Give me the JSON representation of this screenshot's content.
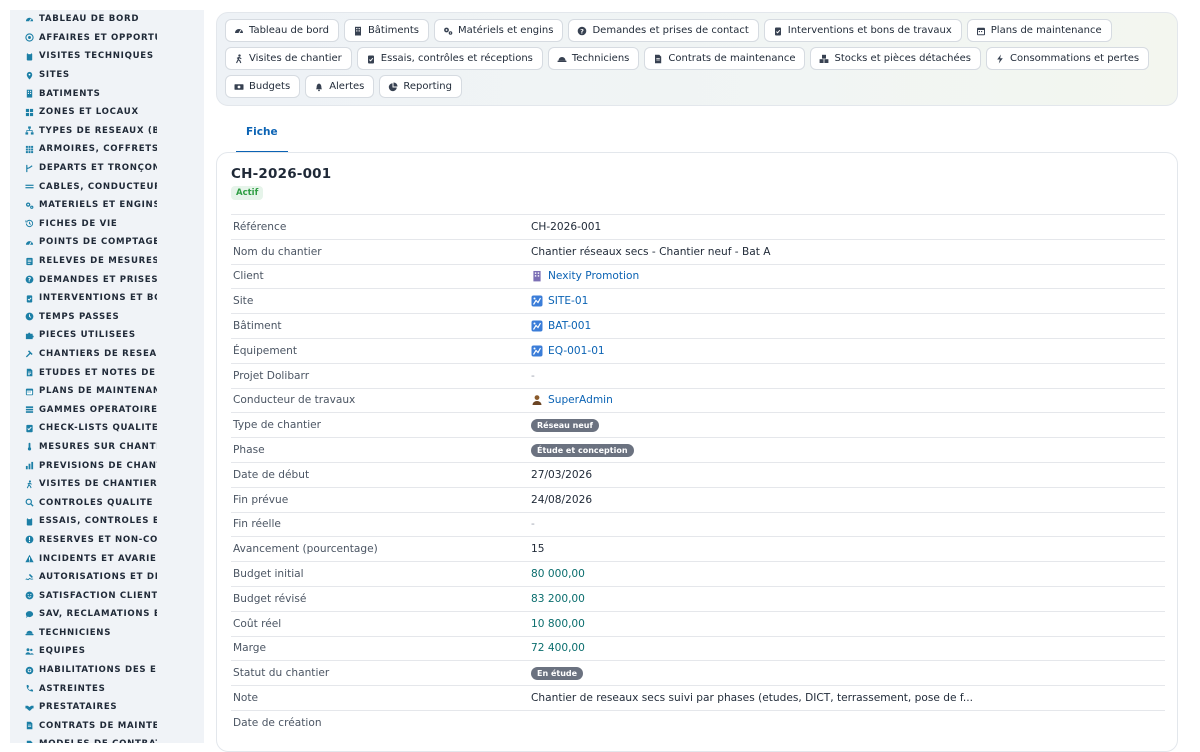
{
  "sidebar": {
    "items": [
      {
        "label": "TABLEAU DE BORD",
        "icon": "dashboard-icon"
      },
      {
        "label": "AFFAIRES ET OPPORTUNITÉS",
        "icon": "target-icon"
      },
      {
        "label": "VISITES TECHNIQUES ET AUDITS",
        "icon": "clipboard-icon"
      },
      {
        "label": "SITES",
        "icon": "map-pin-icon"
      },
      {
        "label": "BÂTIMENTS",
        "icon": "building-icon"
      },
      {
        "label": "ZONES ET LOCAUX",
        "icon": "grid-icon"
      },
      {
        "label": "TYPES DE RÉSEAUX (BT / HTA)",
        "icon": "network-icon"
      },
      {
        "label": "ARMOIRES, COFFRETS ET TABLEAUX",
        "icon": "cabinet-icon"
      },
      {
        "label": "DÉPARTS ET TRONÇONS",
        "icon": "branch-icon"
      },
      {
        "label": "CÂBLES, CONDUCTEURS",
        "icon": "cable-icon"
      },
      {
        "label": "MATÉRIELS ET ENGINS",
        "icon": "gears-icon"
      },
      {
        "label": "FICHES DE VIE",
        "icon": "history-icon"
      },
      {
        "label": "POINTS DE COMPTAGE ET MESURE",
        "icon": "gauge-icon"
      },
      {
        "label": "RELEVÉS DE MESURES",
        "icon": "list-icon"
      },
      {
        "label": "DEMANDES ET PRISES DE CONTACT",
        "icon": "question-icon"
      },
      {
        "label": "INTERVENTIONS ET BONS DE TRAVAUX",
        "icon": "clipboard-check-icon"
      },
      {
        "label": "TEMPS PASSÉS",
        "icon": "clock-icon"
      },
      {
        "label": "PIÈCES UTILISÉES",
        "icon": "puzzle-icon"
      },
      {
        "label": "CHANTIERS DE RÉSEAUX SECS",
        "icon": "hammer-icon"
      },
      {
        "label": "ÉTUDES ET NOTES DE CALCUL",
        "icon": "document-icon"
      },
      {
        "label": "PLANS DE MAINTENANCE",
        "icon": "calendar-icon"
      },
      {
        "label": "GAMMES OPÉRATOIRES",
        "icon": "layers-icon"
      },
      {
        "label": "CHECK-LISTS QUALITÉ",
        "icon": "checklist-icon"
      },
      {
        "label": "MESURES SUR CHANTIER",
        "icon": "thermometer-icon"
      },
      {
        "label": "PRÉVISIONS DE CHANTIER",
        "icon": "chart-icon"
      },
      {
        "label": "VISITES DE CHANTIER",
        "icon": "walk-icon"
      },
      {
        "label": "CONTRÔLES QUALITÉ",
        "icon": "search-icon"
      },
      {
        "label": "ESSAIS, CONTRÔLES ET RÉCEPTIONS",
        "icon": "clipboard-icon"
      },
      {
        "label": "RÉSERVES ET NON-CONFORMITÉS",
        "icon": "exclamation-icon"
      },
      {
        "label": "INCIDENTS ET AVARIES",
        "icon": "warning-icon"
      },
      {
        "label": "AUTORISATIONS ET DICT",
        "icon": "signature-icon"
      },
      {
        "label": "SATISFACTION CLIENT",
        "icon": "smile-icon"
      },
      {
        "label": "SAV, RÉCLAMATIONS ET GARANTIES",
        "icon": "chat-icon"
      },
      {
        "label": "TECHNICIENS",
        "icon": "hardhat-icon"
      },
      {
        "label": "ÉQUIPES",
        "icon": "users-icon"
      },
      {
        "label": "HABILITATIONS DES ÉQUIPES",
        "icon": "certificate-icon"
      },
      {
        "label": "ASTREINTES",
        "icon": "phone-icon"
      },
      {
        "label": "PRESTATAIRES",
        "icon": "handshake-icon"
      },
      {
        "label": "CONTRATS DE MAINTENANCE",
        "icon": "file-icon"
      },
      {
        "label": "MODÈLES DE CONTRATS",
        "icon": "file-icon"
      }
    ]
  },
  "topnav": {
    "buttons": [
      {
        "label": "Tableau de bord",
        "icon": "dashboard-icon"
      },
      {
        "label": "Bâtiments",
        "icon": "building-icon"
      },
      {
        "label": "Matériels et engins",
        "icon": "gears-icon"
      },
      {
        "label": "Demandes et prises de contact",
        "icon": "question-icon"
      },
      {
        "label": "Interventions et bons de travaux",
        "icon": "clipboard-check-icon"
      },
      {
        "label": "Plans de maintenance",
        "icon": "calendar-icon"
      },
      {
        "label": "Visites de chantier",
        "icon": "walk-icon"
      },
      {
        "label": "Essais, contrôles et réceptions",
        "icon": "clipboard-check-icon"
      },
      {
        "label": "Techniciens",
        "icon": "hardhat-icon"
      },
      {
        "label": "Contrats de maintenance",
        "icon": "file-icon"
      },
      {
        "label": "Stocks et pièces détachées",
        "icon": "boxes-icon"
      },
      {
        "label": "Consommations et pertes",
        "icon": "bolt-icon"
      },
      {
        "label": "Budgets",
        "icon": "money-icon"
      },
      {
        "label": "Alertes",
        "icon": "bell-icon"
      },
      {
        "label": "Reporting",
        "icon": "pie-icon"
      }
    ]
  },
  "tabs": {
    "active": "Fiche"
  },
  "record": {
    "title": "CH-2026-001",
    "status": "Actif",
    "fields": [
      {
        "key": "Référence",
        "value": "CH-2026-001",
        "style": "text"
      },
      {
        "key": "Nom du chantier",
        "value": "Chantier réseaux secs - Chantier neuf - Bat A",
        "style": "text"
      },
      {
        "key": "Client",
        "value": "Nexity Promotion",
        "style": "link",
        "icon": "company-icon"
      },
      {
        "key": "Site",
        "value": "SITE-01",
        "style": "link",
        "icon": "object-icon"
      },
      {
        "key": "Bâtiment",
        "value": "BAT-001",
        "style": "link",
        "icon": "object-icon"
      },
      {
        "key": "Équipement",
        "value": "EQ-001-01",
        "style": "link",
        "icon": "object-icon"
      },
      {
        "key": "Projet Dolibarr",
        "value": "-",
        "style": "muted"
      },
      {
        "key": "Conducteur de travaux",
        "value": "SuperAdmin",
        "style": "link",
        "icon": "user-icon"
      },
      {
        "key": "Type de chantier",
        "value": "Réseau neuf",
        "style": "pill"
      },
      {
        "key": "Phase",
        "value": "Étude et conception",
        "style": "pill"
      },
      {
        "key": "Date de début",
        "value": "27/03/2026",
        "style": "text"
      },
      {
        "key": "Fin prévue",
        "value": "24/08/2026",
        "style": "text"
      },
      {
        "key": "Fin réelle",
        "value": "-",
        "style": "muted"
      },
      {
        "key": "Avancement (pourcentage)",
        "value": "15",
        "style": "text"
      },
      {
        "key": "Budget initial",
        "value": "80 000,00",
        "style": "money"
      },
      {
        "key": "Budget révisé",
        "value": "83 200,00",
        "style": "money"
      },
      {
        "key": "Coût réel",
        "value": "10 800,00",
        "style": "money"
      },
      {
        "key": "Marge",
        "value": "72 400,00",
        "style": "money"
      },
      {
        "key": "Statut du chantier",
        "value": "En étude",
        "style": "pill"
      },
      {
        "key": "Note",
        "value": "Chantier de reseaux secs suivi par phases (etudes, DICT, terrassement, pose de f...",
        "style": "text"
      },
      {
        "key": "Date de création",
        "value": "",
        "style": "text"
      }
    ]
  },
  "colors": {
    "accent": "#0b63b4",
    "money": "#0b6e6e",
    "active_badge": "#2f9e44",
    "pill": "#6b7280"
  }
}
